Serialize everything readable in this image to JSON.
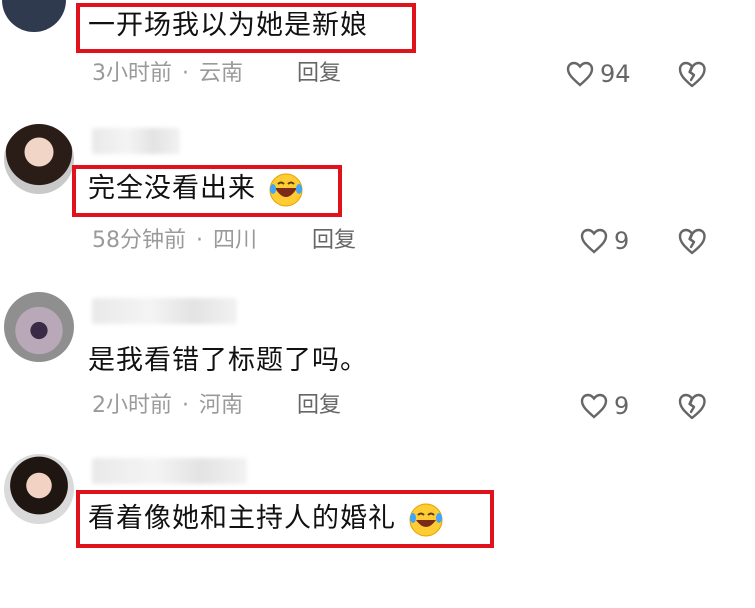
{
  "comments": [
    {
      "text": "一开场我以为她是新娘",
      "time": "3小时前",
      "location": "云南",
      "reply_label": "回复",
      "likes": "94",
      "highlighted": true
    },
    {
      "text": "完全没看出来",
      "emoji": "laughing-crying-emoji",
      "time": "58分钟前",
      "location": "四川",
      "reply_label": "回复",
      "likes": "9",
      "highlighted": true
    },
    {
      "text": "是我看错了标题了吗。",
      "time": "2小时前",
      "location": "河南",
      "reply_label": "回复",
      "likes": "9",
      "highlighted": false
    },
    {
      "text": "看着像她和主持人的婚礼",
      "emoji": "laughing-crying-emoji",
      "highlighted": true
    }
  ],
  "colors": {
    "highlight_border": "#e0121b",
    "meta_text": "#9a9a9a",
    "icon": "#666666"
  }
}
